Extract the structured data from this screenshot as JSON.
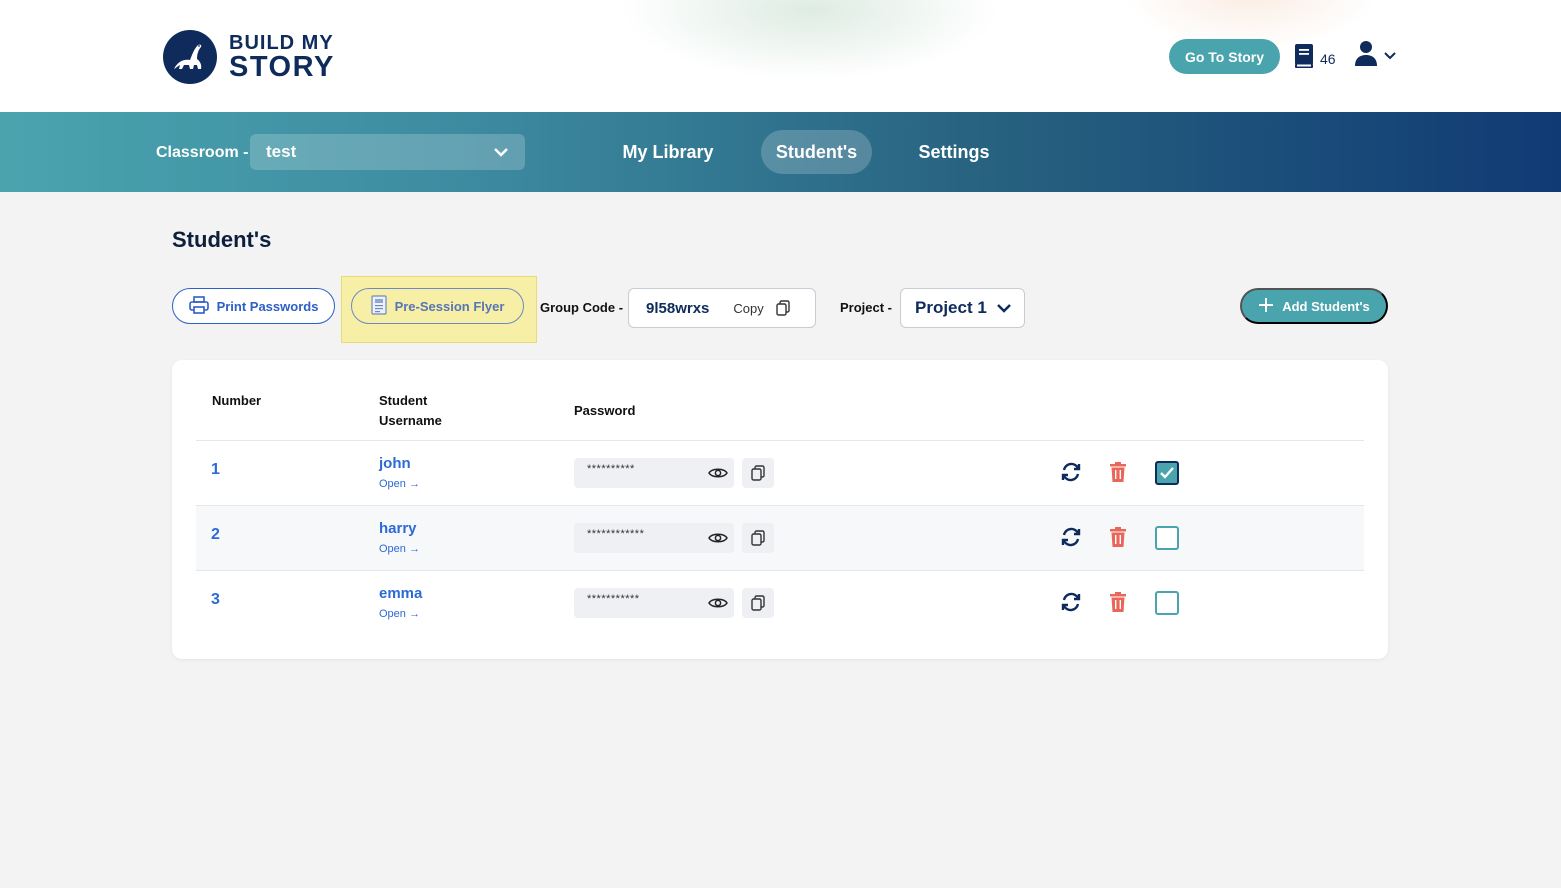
{
  "header": {
    "logo_line1": "BUILD MY",
    "logo_line2": "STORY",
    "goto_story_label": "Go To Story",
    "books_count": "46"
  },
  "nav": {
    "classroom_label": "Classroom -",
    "classroom_value": "test",
    "items": [
      {
        "label": "My Library",
        "active": false
      },
      {
        "label": "Student's",
        "active": true
      },
      {
        "label": "Settings",
        "active": false
      }
    ]
  },
  "page": {
    "title": "Student's",
    "print_passwords_label": "Print Passwords",
    "pre_session_flyer_label": "Pre-Session Flyer",
    "group_code_label": "Group Code -",
    "group_code_value": "9l58wrxs",
    "copy_label": "Copy",
    "project_label": "Project -",
    "project_value": "Project 1",
    "add_students_label": "Add Student's"
  },
  "table": {
    "headers": {
      "number": "Number",
      "username_line1": "Student",
      "username_line2": "Username",
      "password": "Password"
    },
    "rows": [
      {
        "number": "1",
        "username": "john",
        "open": "Open →",
        "password_mask": "**********",
        "checked": true
      },
      {
        "number": "2",
        "username": "harry",
        "open": "Open →",
        "password_mask": "************",
        "checked": false
      },
      {
        "number": "3",
        "username": "emma",
        "open": "Open →",
        "password_mask": "***********",
        "checked": false
      }
    ]
  },
  "icons": {
    "logo": "dinosaur-logo-icon",
    "books": "book-icon",
    "user": "user-icon",
    "print": "printer-icon",
    "flyer": "document-icon",
    "copy": "copy-icon",
    "add": "plus-icon",
    "reveal": "eye-icon",
    "reset": "refresh-icon",
    "delete": "trash-icon"
  },
  "colors": {
    "accent_teal": "#4aa4ae",
    "navy": "#0f2b5c",
    "link_blue": "#2c6ad6",
    "delete_red": "#e8675a",
    "highlight_yellow": "#f7efa6"
  }
}
